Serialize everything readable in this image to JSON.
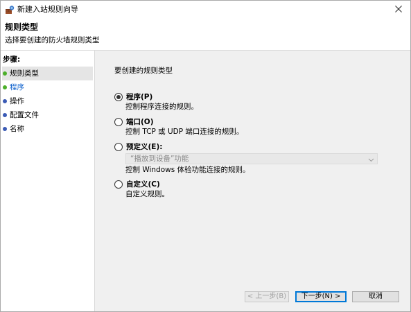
{
  "window": {
    "title": "新建入站规则向导",
    "icon": "firewall-wizard-icon",
    "close_icon": "close-icon"
  },
  "header": {
    "title": "规则类型",
    "subtitle": "选择要创建的防火墙规则类型"
  },
  "steps": {
    "label": "步骤:",
    "items": [
      {
        "label": "规则类型",
        "state": "current",
        "dot_color": "#4caf2a"
      },
      {
        "label": "程序",
        "state": "link",
        "dot_color": "#4caf2a"
      },
      {
        "label": "操作",
        "state": "pending",
        "dot_color": "#3b5bb5"
      },
      {
        "label": "配置文件",
        "state": "pending",
        "dot_color": "#3b5bb5"
      },
      {
        "label": "名称",
        "state": "pending",
        "dot_color": "#3b5bb5"
      }
    ]
  },
  "main": {
    "question": "要创建的规则类型",
    "options": [
      {
        "label": "程序(P)",
        "desc": "控制程序连接的规则。",
        "checked": true
      },
      {
        "label": "端口(O)",
        "desc": "控制 TCP 或 UDP 端口连接的规则。",
        "checked": false
      },
      {
        "label": "预定义(E):",
        "checked": false
      },
      {
        "label": "自定义(C)",
        "desc": "自定义规则。",
        "checked": false
      }
    ],
    "predefined": {
      "selected": "“播放到设备”功能",
      "desc": "控制 Windows 体验功能连接的规则。"
    }
  },
  "buttons": {
    "back": "< 上一步(B)",
    "next": "下一步(N) >",
    "cancel": "取消"
  },
  "colors": {
    "accent": "#0078d7",
    "link": "#0b5fcc",
    "pane_bg": "#f0f0f0"
  }
}
